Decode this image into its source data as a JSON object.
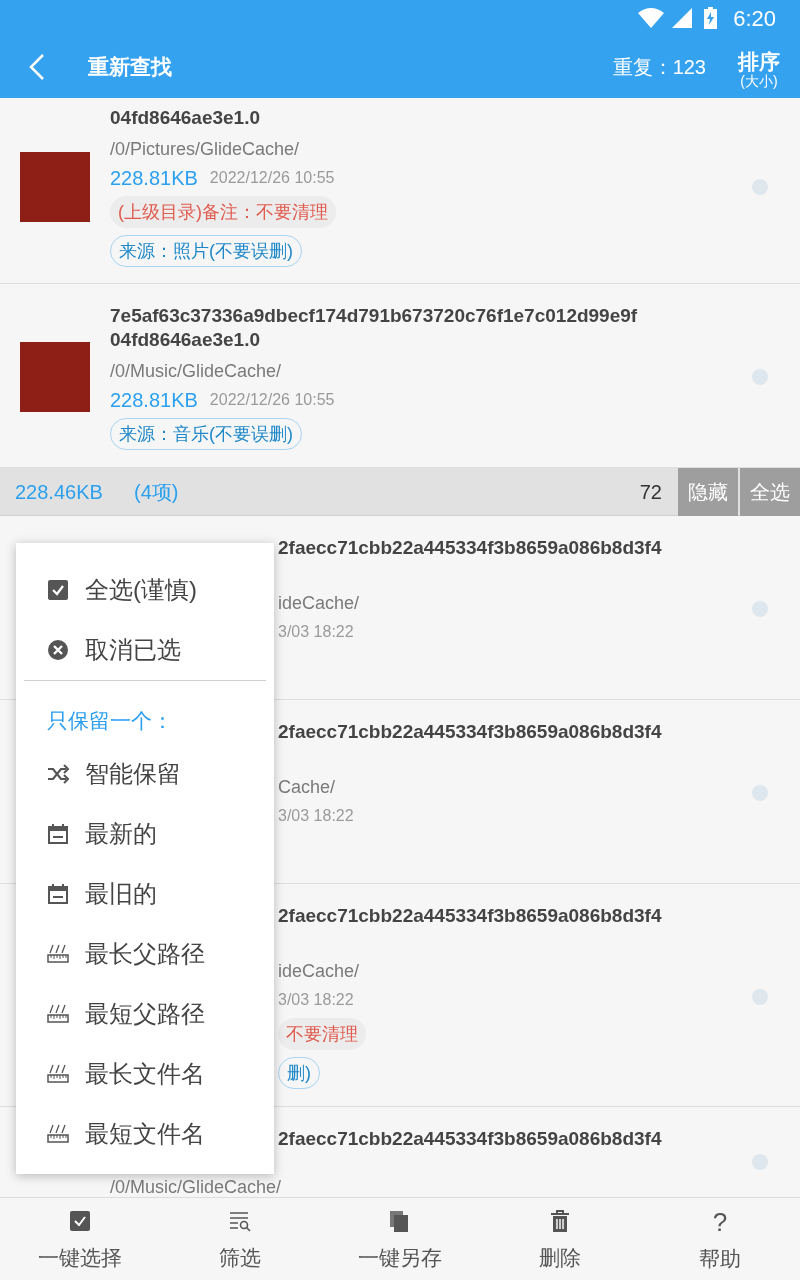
{
  "status_bar": {
    "time": "6:20"
  },
  "app_bar": {
    "title": "重新查找",
    "duplicates": "重复：123",
    "sort": {
      "label": "排序",
      "sub": "(大小)"
    }
  },
  "list": [
    {
      "kind": "full",
      "title_lines": [
        "04fd8646ae3e1.0"
      ],
      "path": "/0/Pictures/GlideCache/",
      "size": "228.81KB",
      "date": "2022/12/26 10:55",
      "remark": "(上级目录)备注：不要清理",
      "source": "来源：照片(不要误删)",
      "checked": false
    },
    {
      "kind": "full",
      "title_lines": [
        "7e5af63c37336a9dbecf174d791b673720c76f1e7c012d99e9f",
        "04fd8646ae3e1.0"
      ],
      "path": "/0/Music/GlideCache/",
      "size": "228.81KB",
      "date": "2022/12/26 10:55",
      "source": "来源：音乐(不要误删)",
      "checked": false
    },
    {
      "kind": "group",
      "size": "228.46KB",
      "count": "(4项)",
      "number": "72",
      "buttons": [
        "隐藏",
        "全选"
      ]
    },
    {
      "kind": "partial",
      "title": "2faecc71cbb22a445334f3b8659a086b8d3f4",
      "path": "ideCache/",
      "date": "3/03 18:22",
      "checked": false
    },
    {
      "kind": "partial",
      "title": "2faecc71cbb22a445334f3b8659a086b8d3f4",
      "path": "Cache/",
      "date": "3/03 18:22",
      "checked": false
    },
    {
      "kind": "partial",
      "title": "2faecc71cbb22a445334f3b8659a086b8d3f4",
      "path": "ideCache/",
      "date": "3/03 18:22",
      "remark": "不要清理",
      "source": "删)",
      "checked": false
    },
    {
      "kind": "tail",
      "title": "2faecc71cbb22a445334f3b8659a086b8d3f4",
      "path": "/0/Music/GlideCache/",
      "checked": false
    }
  ],
  "popup_menu": [
    {
      "kind": "check",
      "label": "全选(谨慎)"
    },
    {
      "kind": "cancel",
      "label": "取消已选"
    },
    {
      "kind": "divider"
    },
    {
      "kind": "heading",
      "label": "只保留一个："
    },
    {
      "kind": "shuffle",
      "label": "智能保留"
    },
    {
      "kind": "calendar",
      "label": "最新的"
    },
    {
      "kind": "calendar",
      "label": "最旧的"
    },
    {
      "kind": "ruler",
      "label": "最长父路径"
    },
    {
      "kind": "ruler",
      "label": "最短父路径"
    },
    {
      "kind": "ruler",
      "label": "最长文件名"
    },
    {
      "kind": "ruler",
      "label": "最短文件名"
    }
  ],
  "bottom_nav": [
    {
      "kind": "check",
      "label": "一键选择"
    },
    {
      "kind": "filter",
      "label": "筛选"
    },
    {
      "kind": "copy",
      "label": "一键另存"
    },
    {
      "kind": "delete",
      "label": "删除"
    },
    {
      "kind": "help",
      "icon_text": "?",
      "label": "帮助"
    }
  ]
}
